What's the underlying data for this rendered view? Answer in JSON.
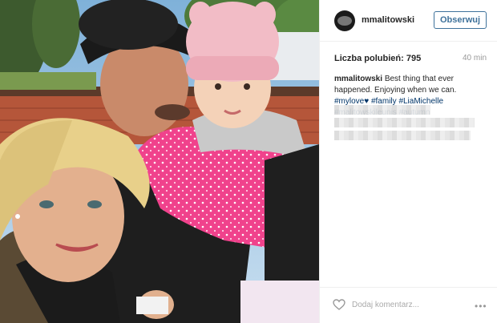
{
  "post": {
    "username": "mmalitowski",
    "follow_label": "Obserwuj",
    "likes_label": "Liczba polubień: 795",
    "time_ago": "40 min",
    "caption_user": "mmalitowski",
    "caption_text": "Best thing that ever happened. Enjoying when we can.",
    "hashtags": [
      "#mylove",
      "#family",
      "#LiaMichelle",
      "#malitowskileunis",
      "#autumn"
    ],
    "heart_emoji": "♥"
  },
  "footer": {
    "comment_placeholder": "Dodaj komentarz...",
    "more_options": "•••"
  },
  "icons": {
    "heart": "heart-outline-icon",
    "more": "more-options-icon"
  },
  "colors": {
    "follow_blue": "#3f729b",
    "hashtag_blue": "#003569",
    "jacket_pink": "#f0428c"
  }
}
